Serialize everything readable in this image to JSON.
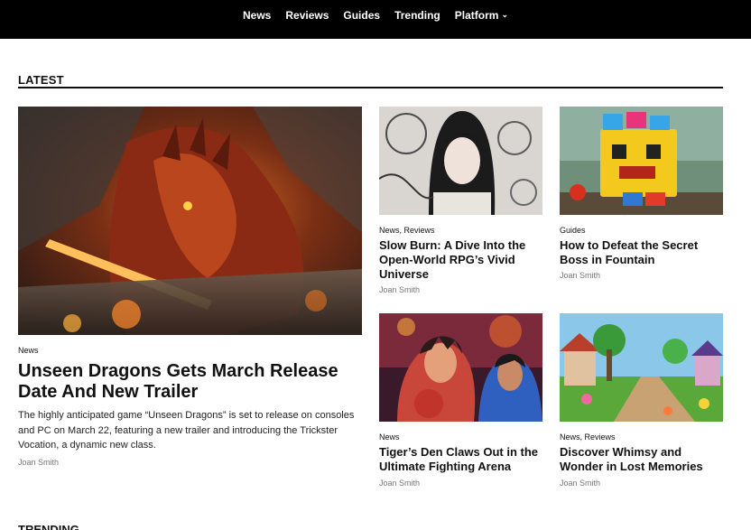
{
  "nav": {
    "items": [
      "News",
      "Reviews",
      "Guides",
      "Trending"
    ],
    "platform": "Platform",
    "platform_icon": "chevron-down-icon"
  },
  "sections": {
    "latest": "LATEST",
    "trending": "TRENDING"
  },
  "featured": {
    "category": "News",
    "title": "Unseen Dragons Gets March Release Date And New Trailer",
    "excerpt": "The highly anticipated game “Unseen Dragons” is set to release on consoles and PC on March 22, featuring a new trailer and introducing the Trickster Vocation, a dynamic new class.",
    "author": "Joan Smith"
  },
  "articles": [
    {
      "category": "News, Reviews",
      "title": "Slow Burn: A Dive Into the Open-World RPG’s Vivid Universe",
      "author": "Joan Smith"
    },
    {
      "category": "Guides",
      "title": "How to Defeat the Secret Boss in Fountain",
      "author": "Joan Smith"
    },
    {
      "category": "News",
      "title": "Tiger’s Den Claws Out in the Ultimate Fighting Arena",
      "author": "Joan Smith"
    },
    {
      "category": "News, Reviews",
      "title": "Discover Whimsy and Wonder in Lost Memories",
      "author": "Joan Smith"
    }
  ]
}
